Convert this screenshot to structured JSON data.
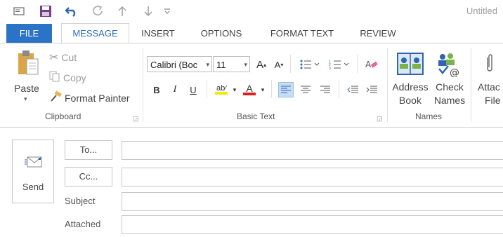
{
  "window": {
    "title": "Untitled"
  },
  "quick_access": [
    {
      "icon": "message-icon"
    },
    {
      "icon": "save-icon"
    },
    {
      "icon": "undo-icon"
    },
    {
      "icon": "redo-icon"
    },
    {
      "icon": "arrow-up-icon"
    },
    {
      "icon": "arrow-down-icon"
    },
    {
      "icon": "customize-icon"
    }
  ],
  "tabs": [
    {
      "label": "FILE"
    },
    {
      "label": "MESSAGE"
    },
    {
      "label": "INSERT"
    },
    {
      "label": "OPTIONS"
    },
    {
      "label": "FORMAT TEXT"
    },
    {
      "label": "REVIEW"
    }
  ],
  "clipboard": {
    "paste_label": "Paste",
    "cut_label": "Cut",
    "copy_label": "Copy",
    "format_painter_label": "Format Painter",
    "group_label": "Clipboard"
  },
  "basic_text": {
    "font_name": "Calibri (Boc",
    "font_size": "11",
    "group_label": "Basic Text",
    "bold": "B",
    "italic": "I",
    "underline": "U"
  },
  "names": {
    "address_book_line1": "Address",
    "address_book_line2": "Book",
    "check_names_line1": "Check",
    "check_names_line2": "Names",
    "group_label": "Names"
  },
  "include": {
    "attach_line1": "Attac",
    "attach_line2": "File"
  },
  "compose": {
    "send_label": "Send",
    "to_label": "To...",
    "cc_label": "Cc...",
    "subject_label": "Subject",
    "attached_label": "Attached",
    "to_value": "",
    "cc_value": "",
    "subject_value": "",
    "attached_value": ""
  },
  "colors": {
    "accent": "#2b73c6",
    "highlight": "#f5e900",
    "font_color": "#e01e1e"
  }
}
